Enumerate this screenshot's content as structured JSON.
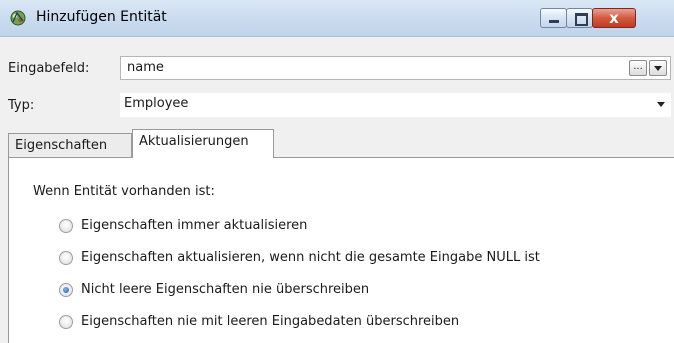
{
  "window": {
    "title": "Hinzufügen Entität",
    "close_glyph": "x"
  },
  "fields": {
    "input_label": "Eingabefeld:",
    "input_value": "name",
    "browse_label": "...",
    "type_label": "Typ:",
    "type_value": "Employee"
  },
  "tabs": [
    {
      "label": "Eigenschaften",
      "active": false
    },
    {
      "label": "Aktualisierungen",
      "active": true
    }
  ],
  "updates": {
    "group_label": "Wenn Entität vorhanden ist:",
    "options": [
      {
        "label": "Eigenschaften immer aktualisieren",
        "checked": false
      },
      {
        "label": "Eigenschaften aktualisieren, wenn nicht die gesamte Eingabe NULL ist",
        "checked": false
      },
      {
        "label": "Nicht leere Eigenschaften nie überschreiben",
        "checked": true
      },
      {
        "label": "Eigenschaften nie mit leeren Eingabedaten überschreiben",
        "checked": false
      }
    ]
  },
  "colors": {
    "radio_selected": "#1a5fb4",
    "close_button": "#c23a20"
  }
}
